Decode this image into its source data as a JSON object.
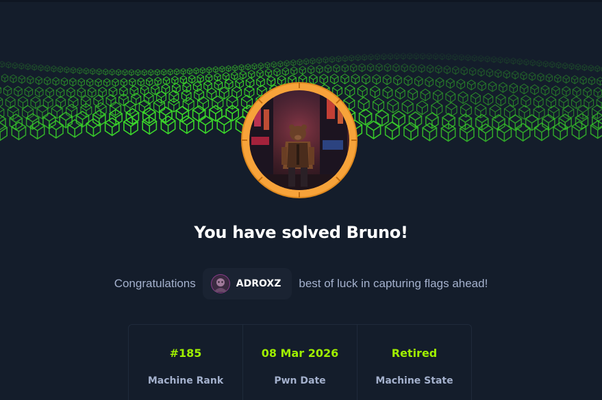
{
  "header": {
    "title": "You have solved Bruno!"
  },
  "congrats": {
    "prefix": "Congratulations",
    "username": "ADROXZ",
    "suffix": "best of luck in capturing flags ahead!"
  },
  "stats": [
    {
      "value": "#185",
      "label": "Machine Rank"
    },
    {
      "value": "08 Mar 2026",
      "label": "Pwn Date"
    },
    {
      "value": "Retired",
      "label": "Machine State"
    }
  ],
  "colors": {
    "background": "#141d2b",
    "accent_green": "#9fef00",
    "ring_orange": "#f7a33a",
    "muted_text": "#a4b1cd",
    "banner_green": "#3bd62a"
  },
  "icons": {
    "machine_avatar": "bear-city-machine-avatar",
    "user_avatar": "user-avatar"
  }
}
